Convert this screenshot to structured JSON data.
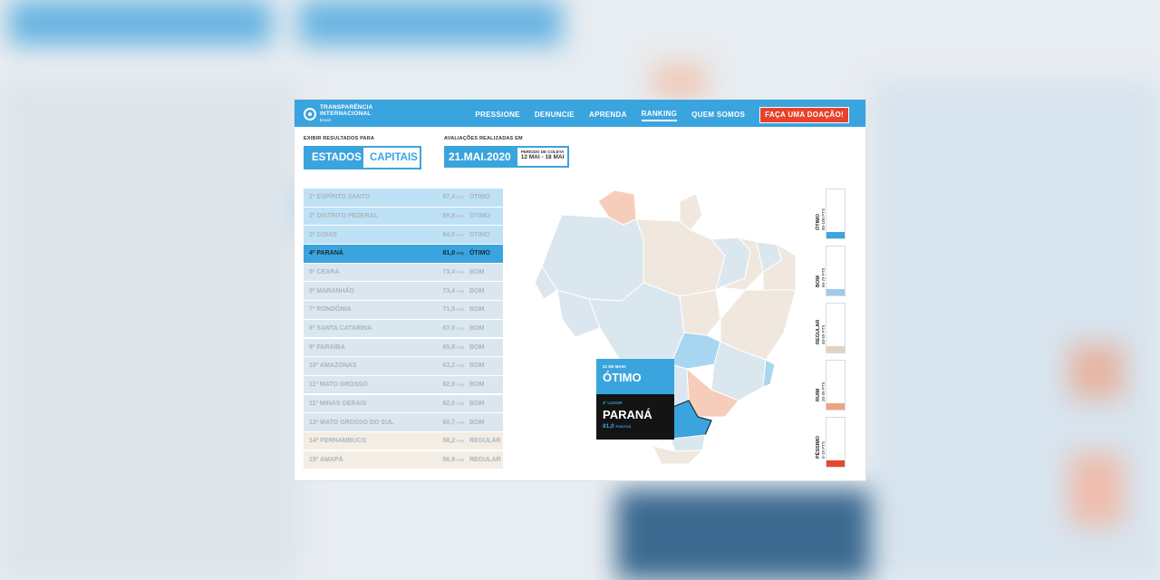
{
  "nav": {
    "logo_line1": "TRANSPARÊNCIA",
    "logo_line2": "INTERNACIONAL",
    "logo_sub": "Brasil",
    "items": [
      "PRESSIONE",
      "DENUNCIE",
      "APRENDA",
      "RANKING",
      "QUEM SOMOS"
    ],
    "active": "RANKING",
    "donate": "FAÇA UMA DOAÇÃO!"
  },
  "filters": {
    "label": "EXIBIR RESULTADOS PARA",
    "option_on": "ESTADOS",
    "option_off": "CAPITAIS"
  },
  "dates": {
    "label": "AVALIAÇÕES REALIZADAS EM",
    "date": "21.MAI.2020",
    "period_label": "PERÍODO DE COLETA",
    "period": "12 MAI - 18 MAI"
  },
  "ranking": [
    {
      "name": "1º ESPÍRITO SANTO",
      "score": "97,4",
      "cls": "ÓTIMO"
    },
    {
      "name": "2º DISTRITO FEDERAL",
      "score": "89,8",
      "cls": "ÓTIMO"
    },
    {
      "name": "3º GOIÁS",
      "score": "84,8",
      "cls": "ÓTIMO"
    },
    {
      "name": "4º PARANÁ",
      "score": "81,0",
      "cls": "ÓTIMO"
    },
    {
      "name": "5º CEARÁ",
      "score": "73,4",
      "cls": "BOM"
    },
    {
      "name": "5º MARANHÃO",
      "score": "73,4",
      "cls": "BOM"
    },
    {
      "name": "7º RONDÔNIA",
      "score": "71,5",
      "cls": "BOM"
    },
    {
      "name": "8º SANTA CATARINA",
      "score": "67,0",
      "cls": "BOM"
    },
    {
      "name": "9º PARAÍBA",
      "score": "65,8",
      "cls": "BOM"
    },
    {
      "name": "10º AMAZONAS",
      "score": "63,2",
      "cls": "BOM"
    },
    {
      "name": "11º MATO GROSSO",
      "score": "62,0",
      "cls": "BOM"
    },
    {
      "name": "11º MINAS GERAIS",
      "score": "62,0",
      "cls": "BOM"
    },
    {
      "name": "13º MATO GROSSO DO SUL",
      "score": "60,7",
      "cls": "BOM"
    },
    {
      "name": "14º PERNAMBUCO",
      "score": "58,2",
      "cls": "REGULAR"
    },
    {
      "name": "15º AMAPÁ",
      "score": "56,9",
      "cls": "REGULAR"
    }
  ],
  "pts_unit": "PTS",
  "selected_index": 3,
  "tooltip": {
    "date": "21 DE MAIO",
    "class": "ÓTIMO",
    "place": "4º LUGAR",
    "state": "PARANÁ",
    "score": "81,0",
    "unit": "PONTOS"
  },
  "legend": [
    {
      "label": "ÓTIMO",
      "range": "80-100 PTS",
      "color": "#3aa4de"
    },
    {
      "label": "BOM",
      "range": "60-79 PTS",
      "color": "#9fcbe6"
    },
    {
      "label": "REGULAR",
      "range": "40-59 PTS",
      "color": "#e0d3c4"
    },
    {
      "label": "RUIM",
      "range": "20-39 PTS",
      "color": "#eea382"
    },
    {
      "label": "PÉSSIMO",
      "range": "0-19 PTS",
      "color": "#e5482d"
    }
  ],
  "colors": {
    "accent": "#3aa4de",
    "donate": "#e8412c",
    "map_bom": "#dbe7ef",
    "map_regular": "#f0e8de",
    "map_ruim": "#f6cdbb",
    "map_otimo": "#a8d6f1",
    "map_selected": "#3aa4de"
  }
}
